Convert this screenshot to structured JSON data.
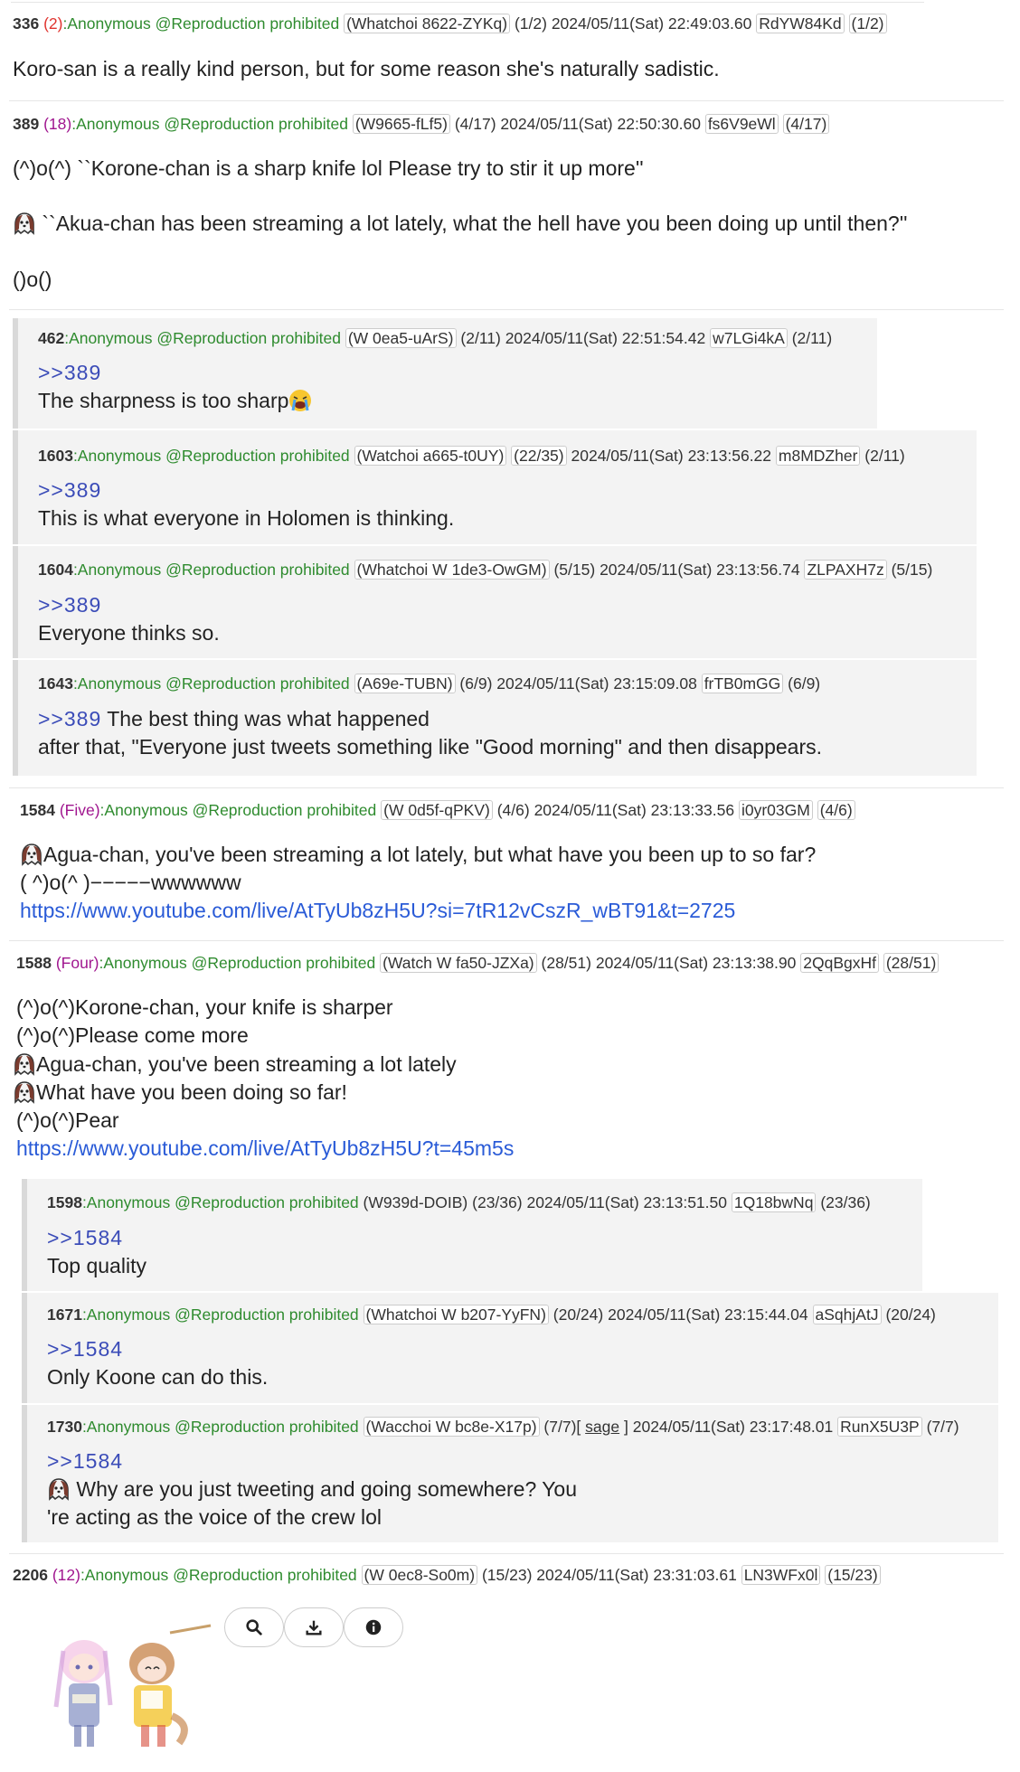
{
  "posts": [
    {
      "num": "336",
      "count": "(2)",
      "name": ":Anonymous @Reproduction prohibited",
      "id": "(Whatchoi 8622-ZYKq)",
      "seq": "(1/2)",
      "date": "2024/05/11(Sat) 22:49:03.60",
      "hash": "RdYW84Kd",
      "seq2": "(1/2)",
      "lines": [
        "Koro-san is a really kind person, but for some reason she's naturally sadistic."
      ]
    },
    {
      "num": "389",
      "count": "(18)",
      "name": ":Anonymous @Reproduction prohibited",
      "id": "(W9665-fLf5)",
      "seq": "(4/17)",
      "date": "2024/05/11(Sat) 22:50:30.60",
      "hash": "fs6V9eWl",
      "seq2": "(4/17)",
      "lines": [
        "(^)o(^) ``Korone-chan is a sharp knife lol Please try to stir it up more''",
        " ``Akua-chan has been streaming a lot lately, what the hell have you been doing up until then?''",
        "()o()"
      ]
    },
    {
      "num": "1584",
      "count": "(Five)",
      "name": ":Anonymous @Reproduction prohibited",
      "id": "(W 0d5f-qPKV)",
      "seq": "(4/6)",
      "date": "2024/05/11(Sat) 23:13:33.56",
      "hash": "i0yr03GM",
      "seq2": "(4/6)",
      "lines": [
        "Agua-chan, you've been streaming a lot lately, but what have you been up to so far?",
        "( ^)o(^ )−−−−−wwwwww"
      ],
      "link": "https://www.youtube.com/live/AtTyUb8zH5U?si=7tR12vCszR_wBT91&t=2725"
    },
    {
      "num": "1588",
      "count": "(Four)",
      "name": ":Anonymous @Reproduction prohibited",
      "id": "(Watch W fa50-JZXa)",
      "seq": "(28/51)",
      "date": "2024/05/11(Sat) 23:13:38.90",
      "hash": "2QqBgxHf",
      "seq2": "(28/51)",
      "lines": [
        "(^)o(^)Korone-chan, your knife is sharper",
        "(^)o(^)Please come more",
        "Agua-chan, you've been streaming a lot lately",
        "What have you been doing so far!",
        "(^)o(^)Pear"
      ],
      "link": "https://www.youtube.com/live/AtTyUb8zH5U?t=45m5s"
    },
    {
      "num": "2206",
      "count": "(12)",
      "name": ":Anonymous @Reproduction prohibited",
      "id": "(W 0ec8-So0m)",
      "seq": "(15/23)",
      "date": "2024/05/11(Sat) 23:31:03.61",
      "hash": "LN3WFx0l",
      "seq2": "(15/23)"
    }
  ],
  "replies389": [
    {
      "num": "462",
      "name": ":Anonymous @Reproduction prohibited",
      "id": "(W 0ea5-uArS)",
      "seq": "(2/11)",
      "date": "2024/05/11(Sat) 22:51:54.42",
      "hash": "w7LGi4kA",
      "seq2": "(2/11)",
      "ref": ">>389",
      "text": "The sharpness is too sharp"
    },
    {
      "num": "1603",
      "name": ":Anonymous @Reproduction prohibited",
      "id": "(Watchoi a665-t0UY)",
      "seq": "(22/35)",
      "date": "2024/05/11(Sat) 23:13:56.22",
      "hash": "m8MDZher",
      "seq2": "(2/11)",
      "ref": ">>389",
      "text": "This is what everyone in Holomen is thinking."
    },
    {
      "num": "1604",
      "name": ":Anonymous @Reproduction prohibited",
      "id": "(Whatchoi W 1de3-OwGM)",
      "seq": "(5/15)",
      "date": "2024/05/11(Sat) 23:13:56.74",
      "hash": "ZLPAXH7z",
      "seq2": "(5/15)",
      "ref": ">>389",
      "text": "Everyone thinks so."
    },
    {
      "num": "1643",
      "name": ":Anonymous @Reproduction prohibited",
      "id": "(A69e-TUBN)",
      "seq": "(6/9)",
      "date": "2024/05/11(Sat) 23:15:09.08",
      "hash": "frTB0mGG",
      "seq2": "(6/9)",
      "ref": ">>389",
      "text": " The best thing was what happened",
      "text2": "after that, \"Everyone just tweets something like \"Good morning\" and then disappears."
    }
  ],
  "replies1584": [
    {
      "num": "1598",
      "name": ":Anonymous @Reproduction prohibited",
      "id": "(W939d-DOIB)",
      "seq": "(23/36)",
      "date": "2024/05/11(Sat) 23:13:51.50",
      "hash": "1Q18bwNq",
      "seq2": "(23/36)",
      "ref": ">>1584",
      "text": "Top quality"
    },
    {
      "num": "1671",
      "name": ":Anonymous @Reproduction prohibited",
      "id": "(Whatchoi W b207-YyFN)",
      "seq": "(20/24)",
      "date": "2024/05/11(Sat) 23:15:44.04",
      "hash": "aSqhjAtJ",
      "seq2": "(20/24)",
      "ref": ">>1584",
      "text": "Only Koone can do this."
    },
    {
      "num": "1730",
      "name": ":Anonymous @Reproduction prohibited",
      "id": "(Wacchoi W bc8e-X17p)",
      "seq": "(7/7)[",
      "sage": "sage",
      "seqend": "]",
      "date": "2024/05/11(Sat) 23:17:48.01",
      "hash": "RunX5U3P",
      "seq2": "(7/7)",
      "ref": ">>1584",
      "text": " Why are you just tweeting and going somewhere? You",
      "text2": "'re acting as the voice of the crew lol"
    }
  ],
  "toolbar": {
    "icons": [
      "search-icon",
      "download-icon",
      "info-icon"
    ]
  }
}
